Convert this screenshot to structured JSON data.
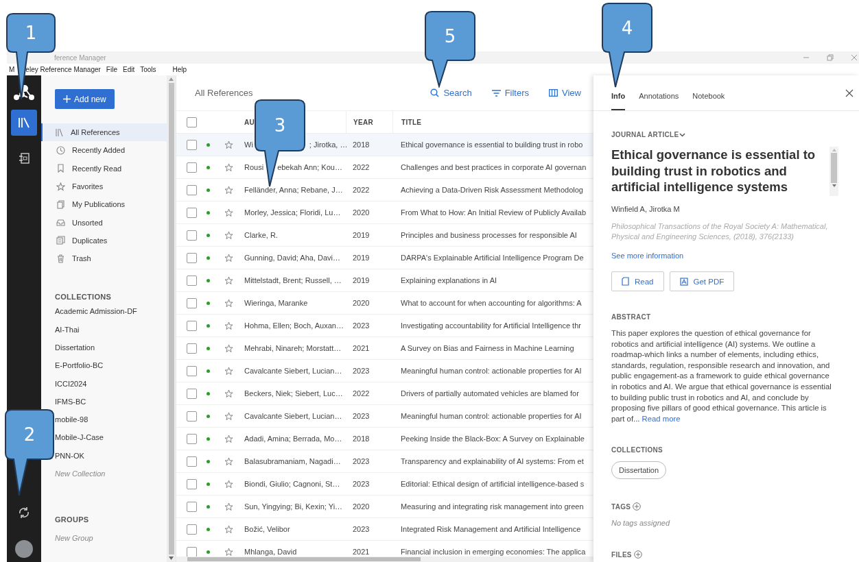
{
  "window": {
    "title": "ference Manager"
  },
  "menu": [
    "M",
    "eley Reference Manager",
    "File",
    "Edit",
    "Tools",
    "Help"
  ],
  "rail": {
    "items": [
      {
        "selected": true
      },
      {
        "selected": false
      }
    ]
  },
  "sidebar": {
    "add_button": "Add new",
    "items": [
      {
        "label": "All References",
        "selected": true
      },
      {
        "label": "Recently Added",
        "selected": false
      },
      {
        "label": "Recently Read",
        "selected": false
      },
      {
        "label": "Favorites",
        "selected": false
      },
      {
        "label": "My Publications",
        "selected": false
      },
      {
        "label": "Unsorted",
        "selected": false
      },
      {
        "label": "Duplicates",
        "selected": false
      },
      {
        "label": "Trash",
        "selected": false
      }
    ],
    "collections_heading": "COLLECTIONS",
    "collections": [
      "Academic Admission-DF",
      "AI-Thai",
      "Dissertation",
      "E-Portfolio-BC",
      "ICCI2024",
      "IFMS-BC",
      "mobile-98",
      "Mobile-J-Case",
      "PNN-OK"
    ],
    "new_collection": "New Collection",
    "groups_heading": "GROUPS",
    "new_group": "New Group"
  },
  "toolbar": {
    "title": "All References",
    "search": "Search",
    "filters": "Filters",
    "view": "View"
  },
  "table": {
    "columns": [
      "AU",
      "YEAR",
      "TITLE"
    ],
    "all_checked": false,
    "rows": [
      {
        "author": [
          "Wi",
          "; Jirotka, …"
        ],
        "year": "2018",
        "title": "Ethical governance is essential to building trust in robo",
        "selected": true,
        "checked": false,
        "unread": true,
        "favorite": false
      },
      {
        "author": [
          "Rousi",
          "ebekah Ann; Kou…"
        ],
        "year": "2022",
        "title": "Challenges and best practices in corporate AI governan",
        "selected": false,
        "checked": false,
        "unread": true,
        "favorite": false
      },
      {
        "author": [
          "Felländer, Anna; Rebane, J…"
        ],
        "year": "2022",
        "title": "Achieving a Data-Driven Risk Assessment Methodolog",
        "selected": false,
        "checked": false,
        "unread": true,
        "favorite": false
      },
      {
        "author": [
          "Morley, Jessica; Floridi, Lu…"
        ],
        "year": "2020",
        "title": "From What to How: An Initial Review of Publicly Availab",
        "selected": false,
        "checked": false,
        "unread": true,
        "favorite": false
      },
      {
        "author": [
          "Clarke, R."
        ],
        "year": "2019",
        "title": "Principles and business processes for responsible AI",
        "selected": false,
        "checked": false,
        "unread": true,
        "favorite": false
      },
      {
        "author": [
          "Gunning, David; Aha, Davi…"
        ],
        "year": "2019",
        "title": "DARPA's Explainable Artificial Intelligence Program De",
        "selected": false,
        "checked": false,
        "unread": true,
        "favorite": false
      },
      {
        "author": [
          "Mittelstadt, Brent; Russell, …"
        ],
        "year": "2019",
        "title": "Explaining explanations in AI",
        "selected": false,
        "checked": false,
        "unread": true,
        "favorite": false
      },
      {
        "author": [
          "Wieringa, Maranke"
        ],
        "year": "2020",
        "title": "What to account for when accounting for algorithms: A",
        "selected": false,
        "checked": false,
        "unread": true,
        "favorite": false
      },
      {
        "author": [
          "Hohma, Ellen; Boch, Auxan…"
        ],
        "year": "2023",
        "title": "Investigating accountability for Artificial Intelligence thr",
        "selected": false,
        "checked": false,
        "unread": true,
        "favorite": false
      },
      {
        "author": [
          "Mehrabi, Ninareh; Morstatt…"
        ],
        "year": "2021",
        "title": "A Survey on Bias and Fairness in Machine Learning",
        "selected": false,
        "checked": false,
        "unread": true,
        "favorite": false
      },
      {
        "author": [
          "Cavalcante Siebert, Lucian…"
        ],
        "year": "2023",
        "title": "Meaningful human control: actionable properties for AI",
        "selected": false,
        "checked": false,
        "unread": true,
        "favorite": false
      },
      {
        "author": [
          "Beckers, Niek; Siebert, Luc…"
        ],
        "year": "2022",
        "title": "Drivers of partially automated vehicles are blamed for",
        "selected": false,
        "checked": false,
        "unread": true,
        "favorite": false
      },
      {
        "author": [
          "Cavalcante Siebert, Lucian…"
        ],
        "year": "2023",
        "title": "Meaningful human control: actionable properties for AI",
        "selected": false,
        "checked": false,
        "unread": true,
        "favorite": false
      },
      {
        "author": [
          "Adadi, Amina; Berrada, Mo…"
        ],
        "year": "2018",
        "title": "Peeking Inside the Black-Box: A Survey on Explainable",
        "selected": false,
        "checked": false,
        "unread": true,
        "favorite": false
      },
      {
        "author": [
          "Balasubramaniam, Nagadi…"
        ],
        "year": "2023",
        "title": "Transparency and explainability of AI systems: From et",
        "selected": false,
        "checked": false,
        "unread": true,
        "favorite": false
      },
      {
        "author": [
          "Biondi, Giulio; Cagnoni, St…"
        ],
        "year": "2023",
        "title": "Editorial: Ethical design of artificial intelligence-based s",
        "selected": false,
        "checked": false,
        "unread": true,
        "favorite": false
      },
      {
        "author": [
          "Sun, Yingying; Bi, Kexin; Yi…"
        ],
        "year": "2020",
        "title": "Measuring and integrating risk management into green",
        "selected": false,
        "checked": false,
        "unread": true,
        "favorite": false
      },
      {
        "author": [
          "Božić, Velibor"
        ],
        "year": "2023",
        "title": "Integrated Risk Management and Artificial Intelligence",
        "selected": false,
        "checked": false,
        "unread": true,
        "favorite": false
      },
      {
        "author": [
          "Mhlanga, David"
        ],
        "year": "2021",
        "title": "Financial inclusion in emerging economies: The applica",
        "selected": false,
        "checked": false,
        "unread": true,
        "favorite": false
      }
    ]
  },
  "details": {
    "tabs": [
      {
        "label": "Info",
        "selected": true
      },
      {
        "label": "Annotations",
        "selected": false
      },
      {
        "label": "Notebook",
        "selected": false
      }
    ],
    "type": "JOURNAL ARTICLE",
    "title": "Ethical governance is essential to building trust in robotics and artificial intelligence systems",
    "authors": "Winfield A, Jirotka M",
    "source": "Philosophical Transactions of the Royal Society A: Mathematical, Physical and Engineering Sciences, (2018), 376(2133)",
    "more_link": "See more information",
    "buttons": [
      "Read",
      "Get PDF"
    ],
    "abstract_heading": "ABSTRACT",
    "abstract": "This paper explores the question of ethical governance for robotics and artificial intelligence (AI) systems. We outline a roadmap-which links a number of elements, including ethics, standards, regulation, responsible research and innovation, and public engagement-as a framework to guide ethical governance in robotics and AI. We argue that ethical governance is essential to building public trust in robotics and AI, and conclude by proposing five pillars of good ethical governance. This article is part of...",
    "read_more": "Read more",
    "collections_heading": "COLLECTIONS",
    "collections": [
      "Dissertation"
    ],
    "tags_heading": "TAGS",
    "tags_empty": "No tags assigned",
    "files_heading": "FILES"
  },
  "callouts": [
    {
      "label": "1"
    },
    {
      "label": "2"
    },
    {
      "label": "3"
    },
    {
      "label": "4"
    },
    {
      "label": "5"
    }
  ]
}
